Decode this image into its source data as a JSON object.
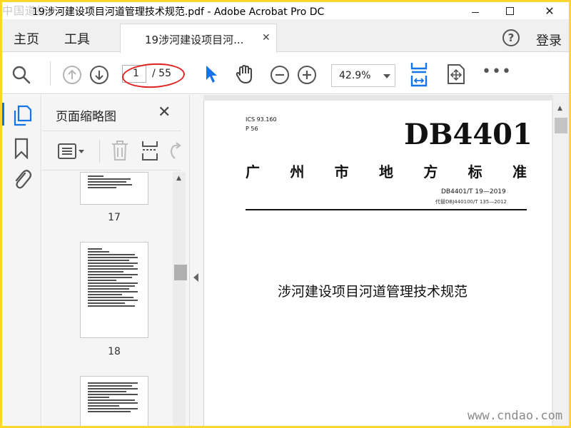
{
  "watermark_top": "中国道标",
  "window": {
    "title": "19涉河建设项目河道管理技术规范.pdf - Adobe Acrobat Pro DC",
    "close_label": "✕"
  },
  "nav": {
    "home": "主页",
    "tools": "工具",
    "tab_label": "19涉河建设项目河...",
    "tab_close": "✕",
    "help": "?",
    "login": "登录"
  },
  "toolbar": {
    "page_current": "1",
    "page_total": "/ 55",
    "zoom": "42.9%",
    "more": "•••"
  },
  "colors": {
    "accent": "#1473e6",
    "highlight": "#e02424",
    "border_frame": "#ffd52e"
  },
  "sidebar": {
    "panel_title": "页面缩略图",
    "close": "✕",
    "thumbnails": [
      {
        "num": "17"
      },
      {
        "num": "18"
      }
    ]
  },
  "document": {
    "ics": "ICS 93.160",
    "pclass": "P 56",
    "code": "DB4401",
    "region_chars": [
      "广",
      "州",
      "市",
      "地",
      "方",
      "标",
      "准"
    ],
    "std_no": "DB4401/T 19—2019",
    "replace": "代替DBJ440100/T 135—2012",
    "title": "涉河建设项目河道管理技术规范"
  },
  "watermark_bottom": "www.cndao.com"
}
